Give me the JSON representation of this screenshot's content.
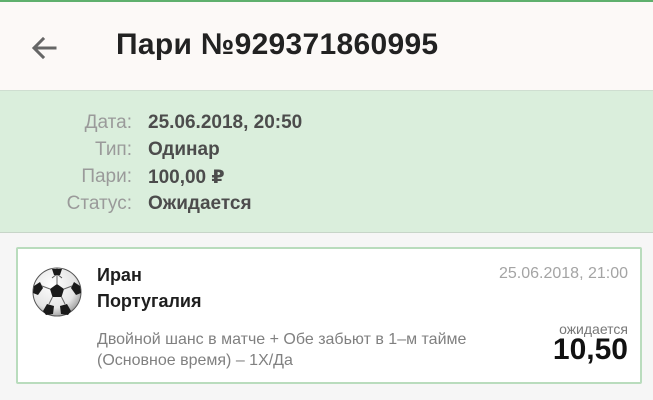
{
  "header": {
    "back_icon": "arrow-left-icon",
    "title": "Пари №929371860995"
  },
  "summary": {
    "rows": [
      {
        "label": "Дата:",
        "value": "25.06.2018, 20:50"
      },
      {
        "label": "Тип:",
        "value": "Одинар"
      },
      {
        "label": "Пари:",
        "value": "100,00 ₽"
      },
      {
        "label": "Статус:",
        "value": "Ожидается"
      }
    ]
  },
  "bet": {
    "sport_icon": "soccer-ball-icon",
    "team1": "Иран",
    "team2": "Португалия",
    "datetime": "25.06.2018, 21:00",
    "description": "Двойной шанс в матче + Обе забьют в 1–м тайме (Основное время) – 1Х/Да",
    "status": "ожидается",
    "coefficient": "10,50"
  },
  "colors": {
    "accent": "#5fb06d",
    "summary_bg": "#daeedc",
    "card_border": "#b9dcbd"
  }
}
